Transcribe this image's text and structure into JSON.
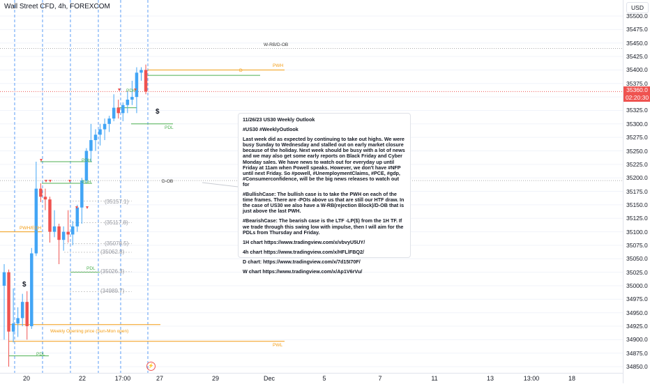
{
  "header": {
    "symbol_title": "Wall Street CFD, 4h, FOREXCOM"
  },
  "price_axis": {
    "currency": "USD",
    "labels": [
      "35500.0",
      "35475.0",
      "35450.0",
      "35425.0",
      "35400.0",
      "35375.0",
      "35350.0",
      "35325.0",
      "35300.0",
      "35275.0",
      "35250.0",
      "35225.0",
      "35200.0",
      "35175.0",
      "35150.0",
      "35125.0",
      "35100.0",
      "35075.0",
      "35050.0",
      "35025.0",
      "35000.0",
      "34975.0",
      "34950.0",
      "34925.0",
      "34900.0",
      "34875.0",
      "34850.0"
    ],
    "current_price": "35360.0",
    "countdown": "02:20:30"
  },
  "time_axis": {
    "labels": [
      "20",
      "22",
      "17:00",
      "27",
      "29",
      "Dec",
      "5",
      "7",
      "11",
      "13",
      "13:00",
      "18"
    ]
  },
  "levels": {
    "w_rb_ob": "W-RB/D-OB",
    "pwh": "PWH",
    "d_label": "D",
    "d_ob": "D-OB",
    "pdh_1": "PDH",
    "pdh_2": "PDH",
    "pdh_3": "PDH",
    "pdl_1": "PDL",
    "pdl_2": "PDL",
    "pdl_3": "PDL",
    "pwh_eqh": "PWH/EQH",
    "weekly_open": "Weekly Opening price (Sun-Mon open)",
    "pwl": "PWL",
    "p1": "(35157.1)",
    "p2": "(35117.8)",
    "p3": "(35078.5)",
    "p4": "(35062.8)",
    "p5": "(35026.3)",
    "p6": "(34989.7)",
    "dollar_1": "$",
    "dollar_2": "$"
  },
  "note": {
    "title": "11/26/23 US30 Weekly Outlook",
    "tags": "#US30  #WeeklyOutlook",
    "para1": "Last week did as expected by continuing to take out highs.  We were busy Sunday to Wednesday and stalled out on early market closure because of the holiday.  Next week should be busy with a lot of news and we may also get some early reports on Black Friday and Cyber Monday sales.  We have news to watch out for everyday up until Friday at 11am when Powell speaks.  However, we don't have #NFP until next Friday.  So #powell, #UnemploymentClaims, #PCE, #gdp, #Consumerconfidence, will be the big news releases to watch out for",
    "para2": "#BullishCase: The bullish case is to take the PWH on each of the time frames.  There are -POIs above us that are still our HTF draw.  In the case of US30 we also have a W-RB(rejection Block)/D-OB that is just above the last PWH.",
    "para3": "#BearishCase: The bearish case is the LTF -LP($) from the 1H TF.  If we trade through this swing low with impulse, then I will aim for the PDLs from Thursday and Friday.",
    "link1": "1H chart https://www.tradingview.com/x/vbvyU5UY/",
    "link2": "4h chart https://www.tradingview.com/x/HFLlFBQ2/",
    "link3": "D chart: https://www.tradingview.com/x/7d15I70F/",
    "link4": "W chart https://www.tradingview.com/x/Ap1V6rVu/"
  },
  "colors": {
    "up": "#42a5f5",
    "down": "#ef5350",
    "level_green": "#4caf50",
    "level_orange": "#f39c12",
    "grid": "#f0f3fa"
  },
  "chart_data": {
    "type": "candlestick",
    "candles": [
      {
        "o": 35000,
        "h": 35040,
        "l": 34900,
        "c": 35025
      },
      {
        "o": 35025,
        "h": 35030,
        "l": 34850,
        "c": 34915
      },
      {
        "o": 34915,
        "h": 34995,
        "l": 34895,
        "c": 34930
      },
      {
        "o": 34930,
        "h": 34960,
        "l": 34905,
        "c": 34940
      },
      {
        "o": 34940,
        "h": 34985,
        "l": 34925,
        "c": 34970
      },
      {
        "o": 34970,
        "h": 34990,
        "l": 34900,
        "c": 34925
      },
      {
        "o": 34925,
        "h": 35070,
        "l": 34920,
        "c": 35060
      },
      {
        "o": 35060,
        "h": 35230,
        "l": 35055,
        "c": 35180
      },
      {
        "o": 35180,
        "h": 35190,
        "l": 35155,
        "c": 35165
      },
      {
        "o": 35165,
        "h": 35180,
        "l": 35140,
        "c": 35160
      },
      {
        "o": 35160,
        "h": 35165,
        "l": 35080,
        "c": 35100
      },
      {
        "o": 35100,
        "h": 35140,
        "l": 35090,
        "c": 35110
      },
      {
        "o": 35110,
        "h": 35115,
        "l": 35040,
        "c": 35085
      },
      {
        "o": 35085,
        "h": 35110,
        "l": 35065,
        "c": 35100
      },
      {
        "o": 35100,
        "h": 35140,
        "l": 35080,
        "c": 35095
      },
      {
        "o": 35095,
        "h": 35120,
        "l": 35075,
        "c": 35110
      },
      {
        "o": 35110,
        "h": 35150,
        "l": 35100,
        "c": 35145
      },
      {
        "o": 35145,
        "h": 35200,
        "l": 35115,
        "c": 35195
      },
      {
        "o": 35195,
        "h": 35255,
        "l": 35190,
        "c": 35250
      },
      {
        "o": 35250,
        "h": 35300,
        "l": 35230,
        "c": 35270
      },
      {
        "o": 35270,
        "h": 35290,
        "l": 35250,
        "c": 35280
      },
      {
        "o": 35280,
        "h": 35300,
        "l": 35260,
        "c": 35290
      },
      {
        "o": 35290,
        "h": 35310,
        "l": 35270,
        "c": 35300
      },
      {
        "o": 35300,
        "h": 35315,
        "l": 35285,
        "c": 35310
      },
      {
        "o": 35310,
        "h": 35355,
        "l": 35305,
        "c": 35330
      },
      {
        "o": 35330,
        "h": 35345,
        "l": 35310,
        "c": 35320
      },
      {
        "o": 35320,
        "h": 35340,
        "l": 35305,
        "c": 35335
      },
      {
        "o": 35335,
        "h": 35360,
        "l": 35320,
        "c": 35345
      },
      {
        "o": 35345,
        "h": 35380,
        "l": 35335,
        "c": 35350
      },
      {
        "o": 35350,
        "h": 35405,
        "l": 35320,
        "c": 35395
      },
      {
        "o": 35395,
        "h": 35405,
        "l": 35380,
        "c": 35400
      },
      {
        "o": 35400,
        "h": 35410,
        "l": 35355,
        "c": 35360
      }
    ],
    "horizontal_levels": [
      35440,
      35400,
      35390,
      35330,
      35300,
      35230,
      35195,
      35180,
      35040,
      35025,
      34920,
      34895
    ],
    "ylim": [
      34840,
      35510
    ]
  }
}
